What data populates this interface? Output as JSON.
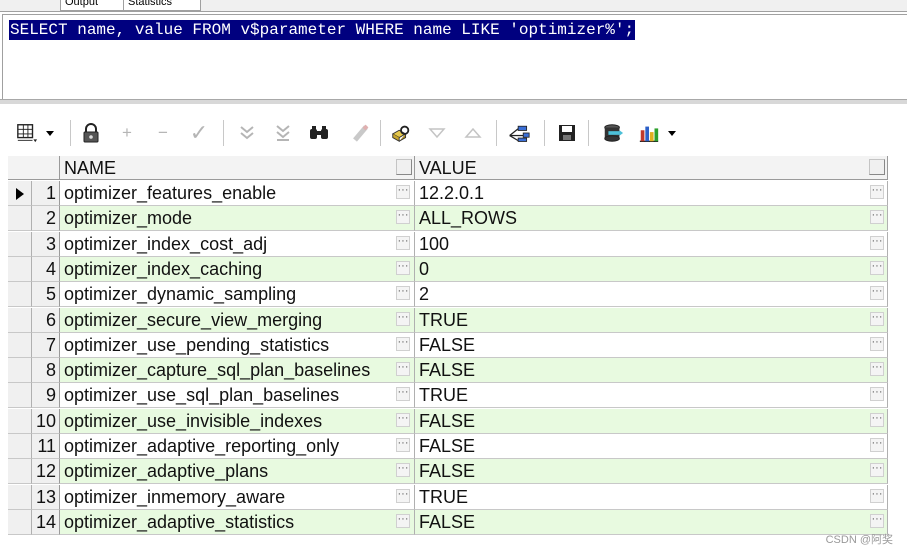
{
  "tabs": [
    "Output",
    "Statistics"
  ],
  "sql": "SELECT name, value FROM v$parameter WHERE name LIKE 'optimizer%';",
  "toolbar": {
    "icons": [
      "grid-options-icon",
      "lock-icon",
      "add-record-icon",
      "delete-record-icon",
      "post-edit-icon",
      "filter-icon",
      "clear-filter-icon",
      "find-icon",
      "clear-icon",
      "query-by-example-icon",
      "sort-desc-icon",
      "sort-asc-icon",
      "tree-view-icon",
      "save-icon",
      "export-icon",
      "chart-icon"
    ]
  },
  "grid": {
    "columns": [
      "NAME",
      "VALUE"
    ],
    "rows": [
      {
        "n": "1",
        "name": "optimizer_features_enable",
        "value": "12.2.0.1"
      },
      {
        "n": "2",
        "name": "optimizer_mode",
        "value": "ALL_ROWS"
      },
      {
        "n": "3",
        "name": "optimizer_index_cost_adj",
        "value": "100"
      },
      {
        "n": "4",
        "name": "optimizer_index_caching",
        "value": "0"
      },
      {
        "n": "5",
        "name": "optimizer_dynamic_sampling",
        "value": "2"
      },
      {
        "n": "6",
        "name": "optimizer_secure_view_merging",
        "value": "TRUE"
      },
      {
        "n": "7",
        "name": "optimizer_use_pending_statistics",
        "value": "FALSE"
      },
      {
        "n": "8",
        "name": "optimizer_capture_sql_plan_baselines",
        "value": "FALSE"
      },
      {
        "n": "9",
        "name": "optimizer_use_sql_plan_baselines",
        "value": "TRUE"
      },
      {
        "n": "10",
        "name": "optimizer_use_invisible_indexes",
        "value": "FALSE"
      },
      {
        "n": "11",
        "name": "optimizer_adaptive_reporting_only",
        "value": "FALSE"
      },
      {
        "n": "12",
        "name": "optimizer_adaptive_plans",
        "value": "FALSE"
      },
      {
        "n": "13",
        "name": "optimizer_inmemory_aware",
        "value": "TRUE"
      },
      {
        "n": "14",
        "name": "optimizer_adaptive_statistics",
        "value": "FALSE"
      }
    ]
  },
  "ellipsis": "···",
  "watermark": "CSDN @阿奖"
}
